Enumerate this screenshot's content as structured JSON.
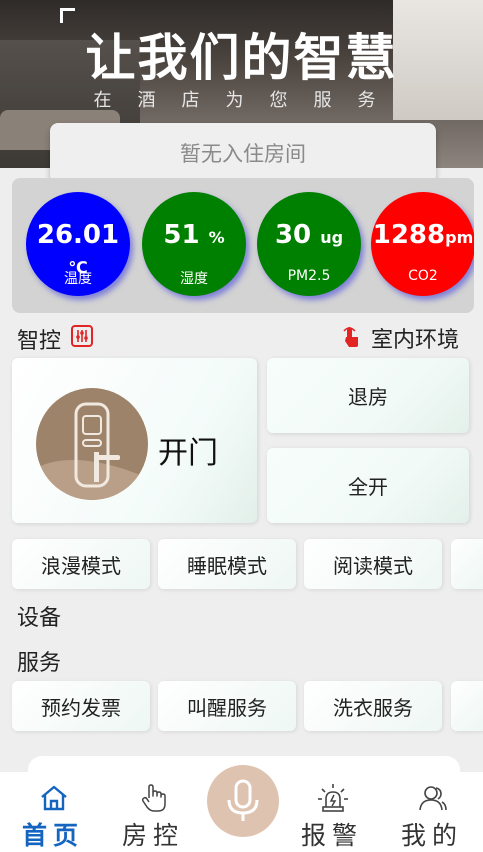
{
  "hero": {
    "title": "让我们的智慧",
    "subtitle": "在酒店为您服务"
  },
  "room_status": "暂无入住房间",
  "sensors": [
    {
      "value": "26.01",
      "unit": "℃",
      "label": "温度",
      "color": "#0000ff"
    },
    {
      "value": "51",
      "unit": "%",
      "label": "湿度",
      "color": "#008000"
    },
    {
      "value": "30",
      "unit": "ug",
      "label": "PM2.5",
      "color": "#008000"
    },
    {
      "value": "1288",
      "unit": "pm",
      "label": "CO2",
      "color": "#ff0000"
    }
  ],
  "control": {
    "title": "智控",
    "env_link": "室内环境",
    "door": "开门",
    "checkout": "退房",
    "all_on": "全开"
  },
  "modes": [
    "浪漫模式",
    "睡眠模式",
    "阅读模式"
  ],
  "sections": {
    "devices": "设备",
    "services": "服务"
  },
  "services": [
    "预约发票",
    "叫醒服务",
    "洗衣服务"
  ],
  "tabbar": {
    "home": "首页",
    "room": "房控",
    "alarm": "报警",
    "mine": "我的",
    "active_color": "#1565c0"
  }
}
